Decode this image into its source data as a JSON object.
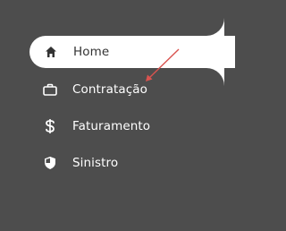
{
  "sidebar": {
    "items": [
      {
        "label": "Home",
        "icon": "home-icon",
        "active": true
      },
      {
        "label": "Contratação",
        "icon": "briefcase-icon",
        "active": false
      },
      {
        "label": "Faturamento",
        "icon": "dollar-icon",
        "active": false
      },
      {
        "label": "Sinistro",
        "icon": "shield-icon",
        "active": false
      }
    ]
  },
  "colors": {
    "sidebar_bg": "#4d4d4d",
    "active_bg": "#ffffff",
    "active_text": "#333333",
    "text": "#ffffff",
    "annotation_arrow": "#d9534f"
  }
}
